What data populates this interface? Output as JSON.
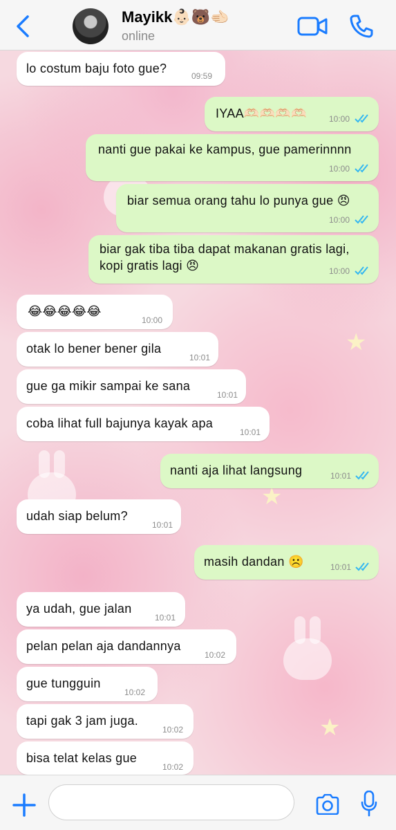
{
  "header": {
    "contact_name": "Mayikk👶🏻🐻🫲🏻",
    "status": "online"
  },
  "colors": {
    "accent": "#1a7cff",
    "outgoing_bubble": "#dcf8c6",
    "incoming_bubble": "#ffffff",
    "read_tick": "#34b7f1"
  },
  "messages": [
    {
      "direction": "in",
      "text": "lo costum baju foto gue?",
      "time": "09:59"
    },
    {
      "direction": "out",
      "text": "IYAA🫶🏻🫶🏻🫶🏻🫶🏻",
      "time": "10:00",
      "read": true
    },
    {
      "direction": "out",
      "text": "nanti gue pakai ke kampus, gue pamerinnnn",
      "time": "10:00",
      "read": true
    },
    {
      "direction": "out",
      "text": "biar semua orang tahu lo punya gue 😠",
      "time": "10:00",
      "read": true
    },
    {
      "direction": "out",
      "text": "biar gak tiba tiba dapat makanan gratis lagi, kopi gratis lagi 😠",
      "time": "10:00",
      "read": true
    },
    {
      "direction": "in",
      "text": "😂😂😂😂😂",
      "time": "10:00"
    },
    {
      "direction": "in",
      "text": "otak lo bener bener gila",
      "time": "10:01"
    },
    {
      "direction": "in",
      "text": "gue ga mikir sampai ke sana",
      "time": "10:01"
    },
    {
      "direction": "in",
      "text": "coba lihat full bajunya kayak apa",
      "time": "10:01"
    },
    {
      "direction": "out",
      "text": "nanti aja lihat langsung",
      "time": "10:01",
      "read": true
    },
    {
      "direction": "in",
      "text": "udah siap belum?",
      "time": "10:01"
    },
    {
      "direction": "out",
      "text": "masih dandan ☹️",
      "time": "10:01",
      "read": true
    },
    {
      "direction": "in",
      "text": "ya udah, gue jalan",
      "time": "10:01"
    },
    {
      "direction": "in",
      "text": "pelan pelan aja dandannya",
      "time": "10:02"
    },
    {
      "direction": "in",
      "text": "gue tungguin",
      "time": "10:02"
    },
    {
      "direction": "in",
      "text": "tapi gak 3 jam juga.",
      "time": "10:02"
    },
    {
      "direction": "in",
      "text": "bisa telat kelas gue",
      "time": "10:02"
    }
  ],
  "composer": {
    "input_value": "",
    "icons": [
      "plus-icon",
      "sticker-icon",
      "camera-icon",
      "microphone-icon"
    ]
  }
}
